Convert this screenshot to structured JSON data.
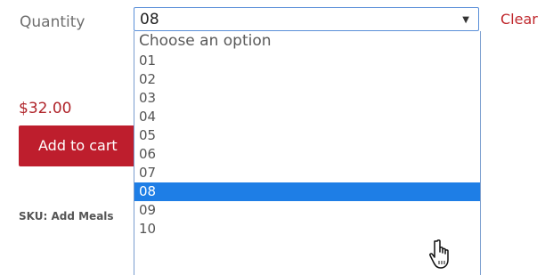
{
  "variation": {
    "label": "Quantity",
    "selected_value": "08",
    "clear_label": "Clear",
    "options": [
      {
        "label": "Choose an option"
      },
      {
        "label": "01"
      },
      {
        "label": "02"
      },
      {
        "label": "03"
      },
      {
        "label": "04"
      },
      {
        "label": "05"
      },
      {
        "label": "06"
      },
      {
        "label": "07"
      },
      {
        "label": "08",
        "selected": true
      },
      {
        "label": "09"
      },
      {
        "label": "10"
      }
    ]
  },
  "product": {
    "price": "$32.00",
    "add_to_cart_label": "Add to cart",
    "sku_label": "SKU:",
    "sku_value": "Add Meals"
  },
  "colors": {
    "accent_red": "#be1e2d",
    "selection_blue": "#1e7ee6",
    "select_border": "#5a8fd8"
  },
  "icons": {
    "dropdown_arrow": "chevron-down-icon",
    "cursor": "hand-pointer-icon"
  }
}
